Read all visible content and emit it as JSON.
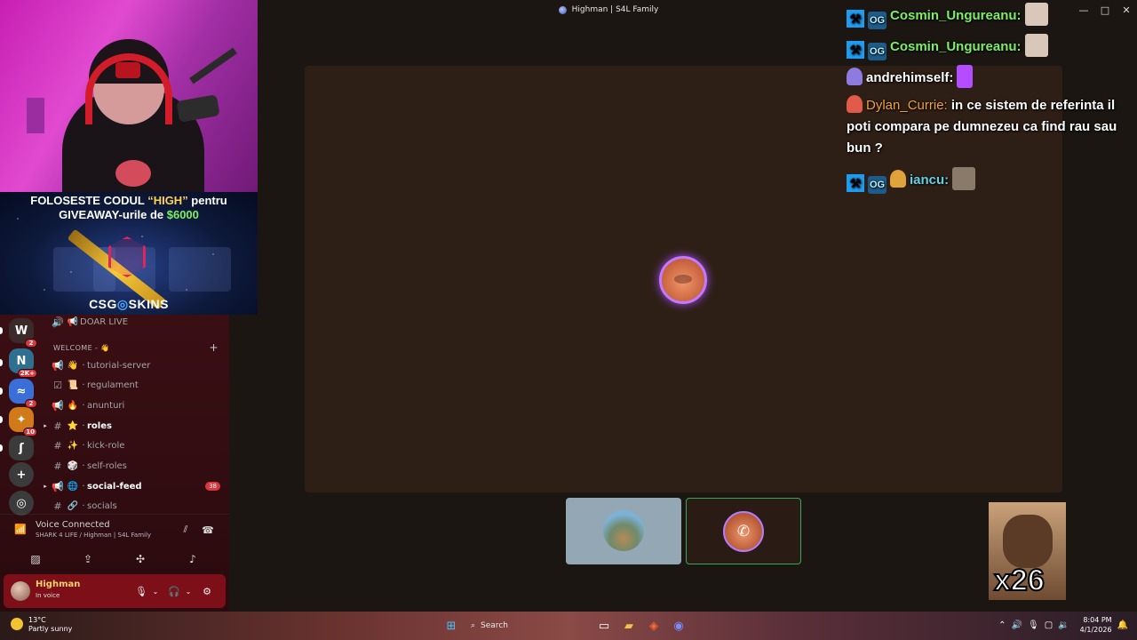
{
  "window": {
    "title": "Highman | S4L Family",
    "controls": [
      "—",
      "□",
      "✕"
    ]
  },
  "promo": {
    "line1_pre": "FOLOSESTE CODUL ",
    "line1_code": "“HIGH”",
    "line1_post": " pentru",
    "line2_pre": "GIVEAWAY-urile de ",
    "line2_amount": "$6000",
    "brand_left": "CSG",
    "brand_dot": "◎",
    "brand_right": "SKINS"
  },
  "servers": [
    {
      "label": "W",
      "badge": "2",
      "color": "#3b2a2a"
    },
    {
      "label": "N",
      "badge": "2K+",
      "color": "#2f6f8f"
    },
    {
      "label": "≈",
      "badge": "2",
      "color": "#3a6fd8"
    },
    {
      "label": "✦",
      "badge": "10",
      "color": "#d07a1a"
    },
    {
      "label": "ʃ",
      "badge": "",
      "color": "#3b3b3b"
    },
    {
      "label": "+",
      "badge": "",
      "color": "#3b3b3b"
    },
    {
      "label": "◎",
      "badge": "",
      "color": "#3b3b3b"
    }
  ],
  "channels": {
    "top_item": {
      "icon": "🔊",
      "emoji": "📢",
      "name": "DOAR LIVE"
    },
    "category": "WELCOME - 👋",
    "items": [
      {
        "icon": "📢",
        "emoji": "👋",
        "name": "tutorial-server",
        "bold": false,
        "pill": ""
      },
      {
        "icon": "☑",
        "emoji": "📜",
        "name": "regulament",
        "bold": false,
        "pill": ""
      },
      {
        "icon": "📢",
        "emoji": "🔥",
        "name": "anunturi",
        "bold": false,
        "pill": ""
      },
      {
        "icon": "#",
        "emoji": "⭐",
        "name": "roles",
        "bold": true,
        "pill": ""
      },
      {
        "icon": "#",
        "emoji": "✨",
        "name": "kick-role",
        "bold": false,
        "pill": ""
      },
      {
        "icon": "#",
        "emoji": "🎲",
        "name": "self-roles",
        "bold": false,
        "pill": ""
      },
      {
        "icon": "📢",
        "emoji": "🌐",
        "name": "social-feed",
        "bold": true,
        "pill": "38"
      },
      {
        "icon": "#",
        "emoji": "🔗",
        "name": "socials",
        "bold": false,
        "pill": ""
      }
    ]
  },
  "voice": {
    "status": "Voice Connected",
    "location": "SHARK 4 LIFE / Highman | S4L Family"
  },
  "user": {
    "name": "Highman",
    "status": "In voice"
  },
  "chat": [
    {
      "badges": [
        "mod",
        "og"
      ],
      "user": "Cosmin_Ungureanu:",
      "color": "#7cf062",
      "text": "",
      "emote": "#d9c8b9"
    },
    {
      "badges": [
        "mod",
        "og"
      ],
      "user": "Cosmin_Ungureanu:",
      "color": "#7cf062",
      "text": "",
      "emote": "#d9c8b9"
    },
    {
      "badges": [
        "sub"
      ],
      "user": "andrehimself:",
      "color": "#ffffff",
      "text": "",
      "emote": "#b44cff"
    },
    {
      "badges": [
        "sub2"
      ],
      "user": "Dylan_Currie:",
      "color": "#f2a23c",
      "text": "in ce sistem de referinta il poti compara pe dumnezeu ca find rau sau bun ?",
      "emote": ""
    },
    {
      "badges": [
        "mod",
        "og",
        "sub3"
      ],
      "user": "iancu:",
      "color": "#5fd3e8",
      "text": "",
      "emote": "#8a7a6a"
    }
  ],
  "emote_widget": {
    "count": "x26"
  },
  "taskbar": {
    "temp": "13°C",
    "weather": "Partly sunny",
    "search": "Search",
    "time": "8:04 PM",
    "date": "4/1/2026"
  }
}
